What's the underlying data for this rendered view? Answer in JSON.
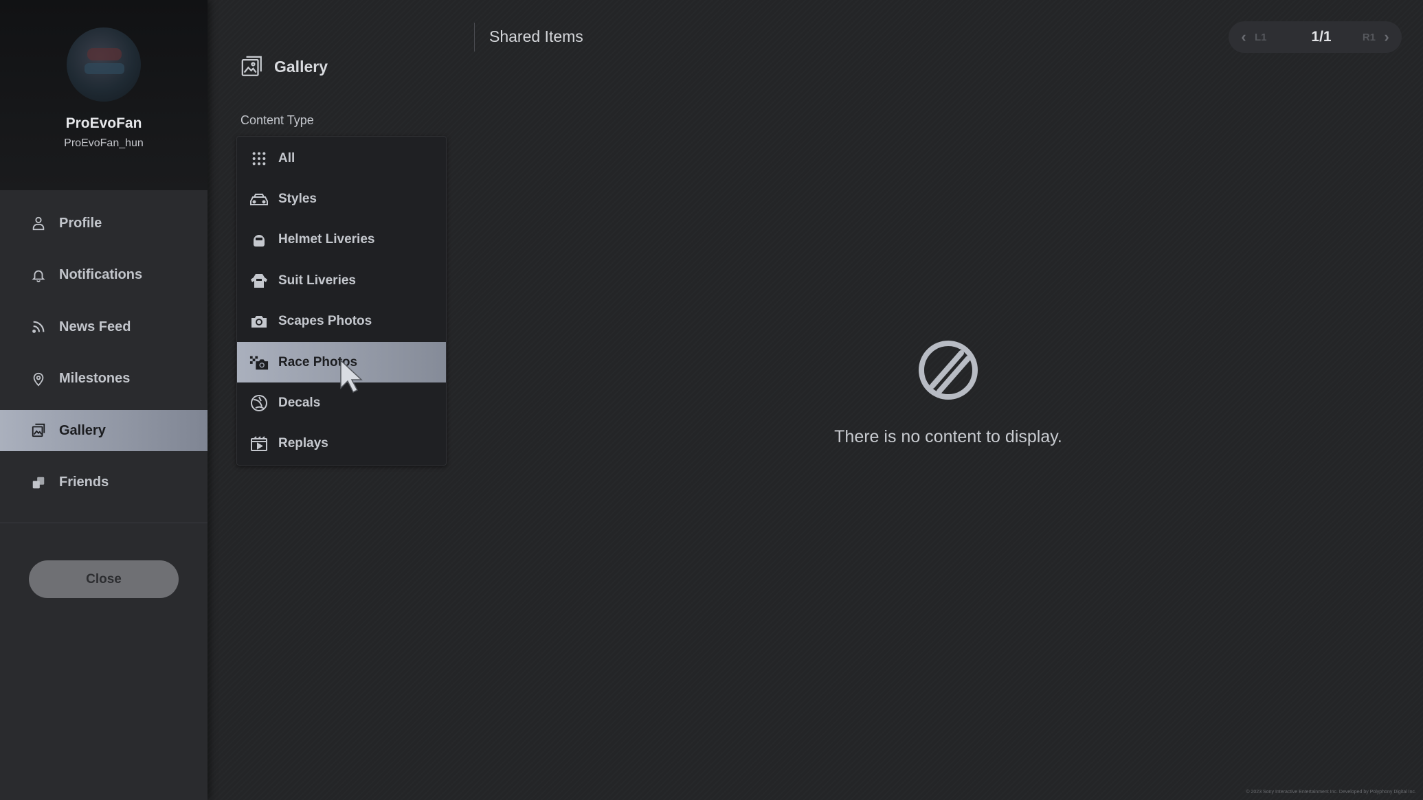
{
  "profile": {
    "display_name": "ProEvoFan",
    "user_id": "ProEvoFan_hun"
  },
  "sidebar": {
    "items": [
      {
        "label": "Profile",
        "icon": "person-icon",
        "active": false
      },
      {
        "label": "Notifications",
        "icon": "bell-icon",
        "active": false
      },
      {
        "label": "News Feed",
        "icon": "rss-icon",
        "active": false
      },
      {
        "label": "Milestones",
        "icon": "location-pin-icon",
        "active": false
      },
      {
        "label": "Gallery",
        "icon": "gallery-icon",
        "active": true
      },
      {
        "label": "Friends",
        "icon": "friends-icon",
        "active": false
      }
    ],
    "close_label": "Close"
  },
  "gallery": {
    "title": "Gallery",
    "content_type_label": "Content Type",
    "content_types": [
      {
        "label": "All",
        "icon": "grid-icon",
        "selected": false
      },
      {
        "label": "Styles",
        "icon": "car-icon",
        "selected": false
      },
      {
        "label": "Helmet Liveries",
        "icon": "helmet-icon",
        "selected": false
      },
      {
        "label": "Suit Liveries",
        "icon": "suit-icon",
        "selected": false
      },
      {
        "label": "Scapes Photos",
        "icon": "camera-icon",
        "selected": false
      },
      {
        "label": "Race Photos",
        "icon": "race-camera-icon",
        "selected": true
      },
      {
        "label": "Decals",
        "icon": "decal-icon",
        "selected": false
      },
      {
        "label": "Replays",
        "icon": "replay-icon",
        "selected": false
      }
    ]
  },
  "main": {
    "section_title": "Shared Items",
    "pager": {
      "prev_label": "L1",
      "next_label": "R1",
      "page": "1/1"
    },
    "empty_message": "There is no content to display."
  },
  "footer": {
    "copyright": "© 2023 Sony Interactive Entertainment Inc. Developed by Polyphony Digital Inc."
  },
  "colors": {
    "background": "#242527",
    "sidebar": "#2a2b2e",
    "active_item": "#aab0bd",
    "text": "#c9ccd2"
  }
}
